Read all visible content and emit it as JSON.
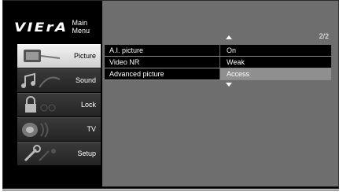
{
  "brand": {
    "logo": "VIErA",
    "menu_title": "Main Menu"
  },
  "sidebar": {
    "items": [
      {
        "label": "Picture",
        "icon": "picture-icon",
        "active": true
      },
      {
        "label": "Sound",
        "icon": "sound-icon",
        "active": false
      },
      {
        "label": "Lock",
        "icon": "lock-icon",
        "active": false
      },
      {
        "label": "TV",
        "icon": "tv-icon",
        "active": false
      },
      {
        "label": "Setup",
        "icon": "setup-icon",
        "active": false
      }
    ]
  },
  "content": {
    "page_indicator": "2/2",
    "rows": [
      {
        "name": "A.I. picture",
        "value": "On",
        "selected": false
      },
      {
        "name": "Video NR",
        "value": "Weak",
        "selected": false
      },
      {
        "name": "Advanced picture",
        "value": "Access",
        "selected": true
      }
    ]
  },
  "colors": {
    "panel": "#6e6e6e",
    "row_bg": "#000000",
    "selected_value": "#8f8f8f",
    "sidebar_active": "#e6e6e6"
  }
}
